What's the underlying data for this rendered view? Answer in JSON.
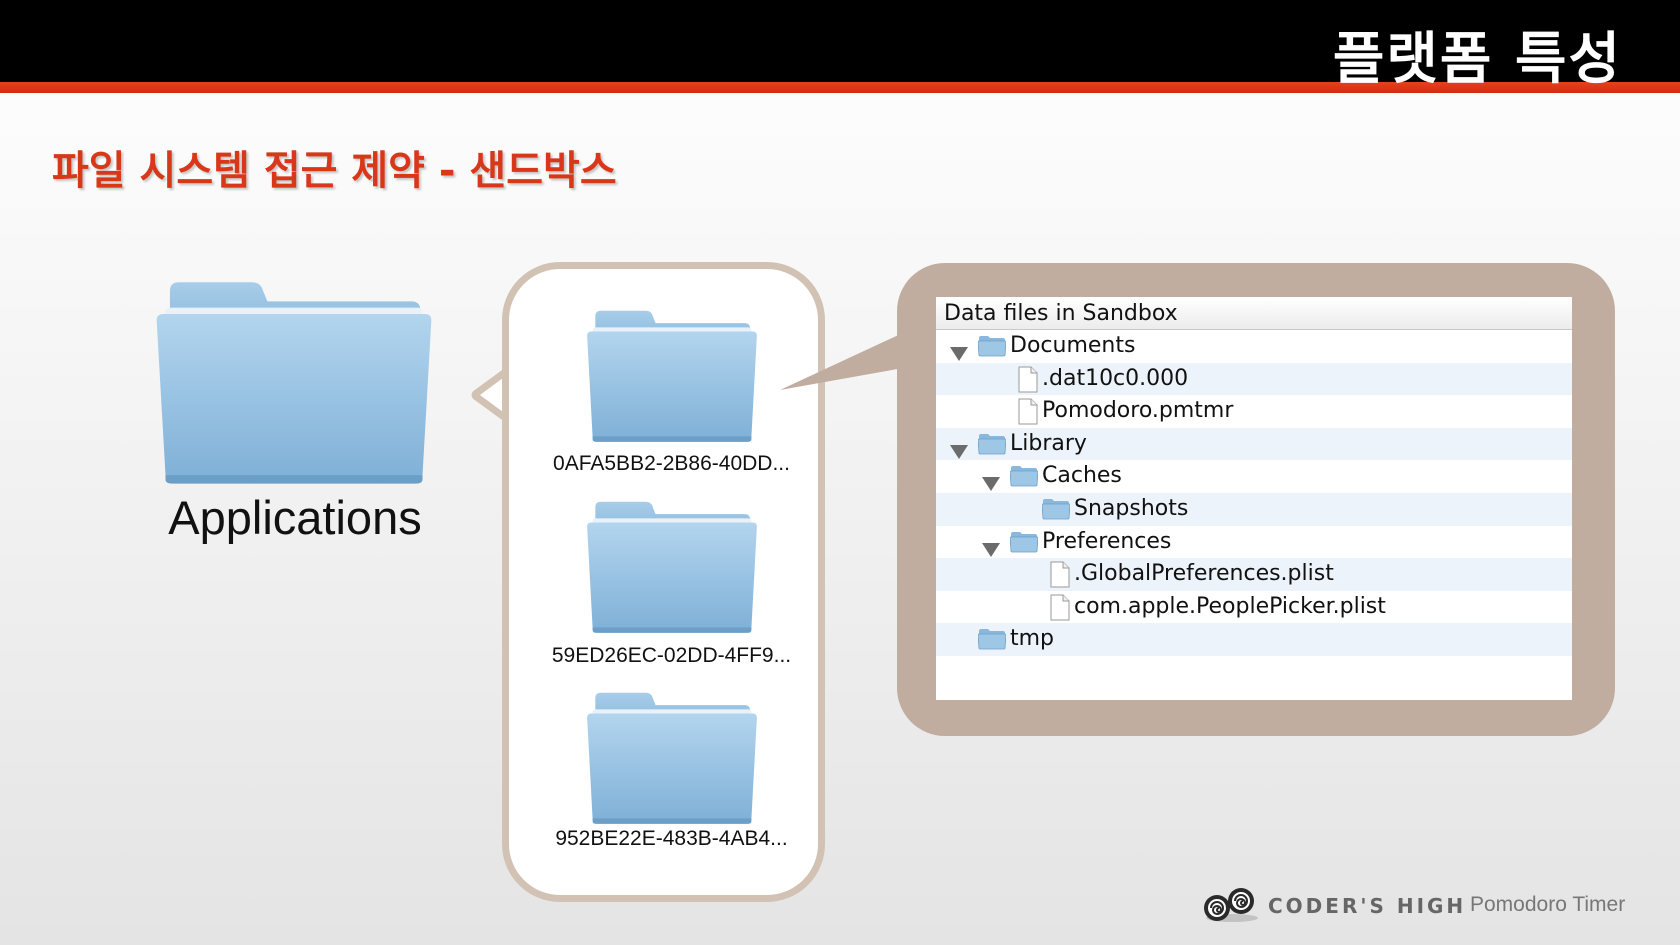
{
  "header": {
    "title": "플랫폼 특성"
  },
  "section": {
    "title": "파일 시스템 접근 제약 - 샌드박스"
  },
  "applications": {
    "label": "Applications"
  },
  "app_containers": [
    {
      "label": "0AFA5BB2-2B86-40DD..."
    },
    {
      "label": "59ED26EC-02DD-4FF9..."
    },
    {
      "label": "952BE22E-483B-4AB4..."
    }
  ],
  "finder": {
    "header": "Data files in Sandbox",
    "rows": [
      {
        "name": "Documents",
        "kind": "folder",
        "expanded": true
      },
      {
        "name": ".dat10c0.000",
        "kind": "file"
      },
      {
        "name": "Pomodoro.pmtmr",
        "kind": "file"
      },
      {
        "name": "Library",
        "kind": "folder",
        "expanded": true
      },
      {
        "name": "Caches",
        "kind": "folder",
        "expanded": true
      },
      {
        "name": "Snapshots",
        "kind": "folder",
        "expanded": false
      },
      {
        "name": "Preferences",
        "kind": "folder",
        "expanded": true
      },
      {
        "name": ".GlobalPreferences.plist",
        "kind": "file"
      },
      {
        "name": "com.apple.PeoplePicker.plist",
        "kind": "file"
      },
      {
        "name": "tmp",
        "kind": "folder",
        "expanded": false
      }
    ]
  },
  "footer": {
    "brand": "CODER'S HIGH",
    "separator": "I",
    "product": "Pomodoro Timer"
  },
  "colors": {
    "accent": "#d8371a",
    "callout": "#c0ada0",
    "bubble_border": "#d2c2b4",
    "folder": "#8fbde0"
  },
  "icons": [
    "folder-icon",
    "file-icon",
    "disclosure-triangle-icon",
    "coders-high-logo"
  ]
}
